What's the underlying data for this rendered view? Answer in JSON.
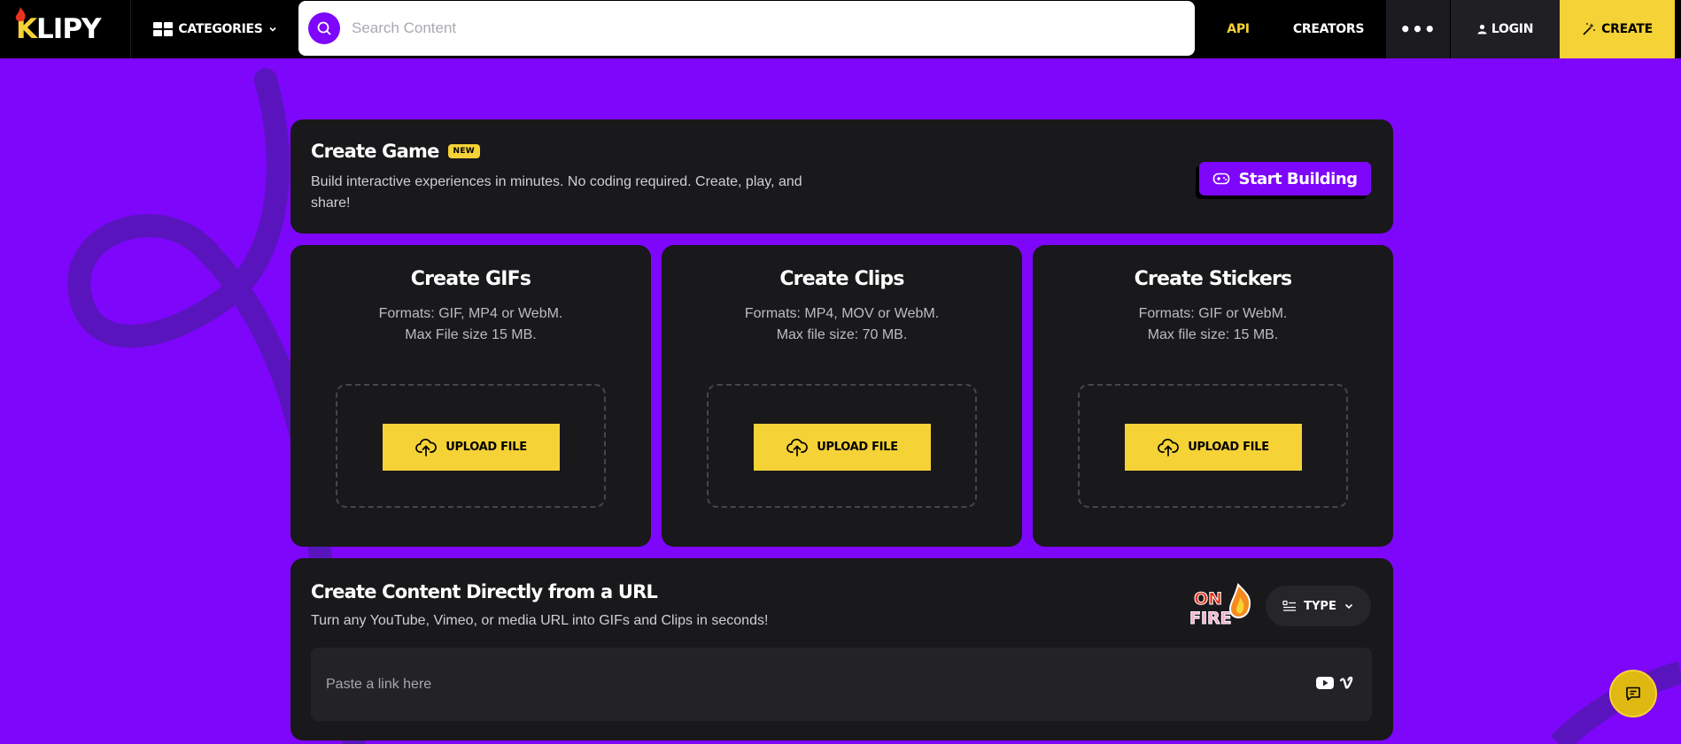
{
  "brand": {
    "name": "KLIPY",
    "accent": "#7e06fb",
    "yellow": "#f5d236"
  },
  "nav": {
    "categories_label": "CATEGORIES",
    "search_placeholder": "Search Content",
    "api_label": "API",
    "creators_label": "CREATORS",
    "more_label": "•••",
    "login_label": "LOGIN",
    "create_label": "CREATE"
  },
  "game": {
    "title": "Create Game",
    "badge": "NEW",
    "description": "Build interactive experiences in minutes. No coding required. Create, play, and share!",
    "button_label": "Start Building"
  },
  "upload_cards": [
    {
      "title": "Create GIFs",
      "formats": "Formats: GIF, MP4 or WebM.",
      "max_size": "Max File size 15 MB.",
      "button_label": "UPLOAD FILE"
    },
    {
      "title": "Create Clips",
      "formats": "Formats: MP4, MOV or WebM.",
      "max_size": "Max file size: 70 MB.",
      "button_label": "UPLOAD FILE"
    },
    {
      "title": "Create Stickers",
      "formats": "Formats: GIF or WebM.",
      "max_size": "Max file size: 15 MB.",
      "button_label": "UPLOAD FILE"
    }
  ],
  "url_section": {
    "title": "Create Content Directly from a URL",
    "description": "Turn any YouTube, Vimeo, or media URL into GIFs and Clips in seconds!",
    "sticker_text_1": "ON",
    "sticker_text_2": "FIRE",
    "type_label": "TYPE",
    "input_placeholder": "Paste a link here",
    "icons": [
      "youtube-icon",
      "vimeo-icon"
    ]
  },
  "chat": {
    "icon": "chat-icon"
  }
}
